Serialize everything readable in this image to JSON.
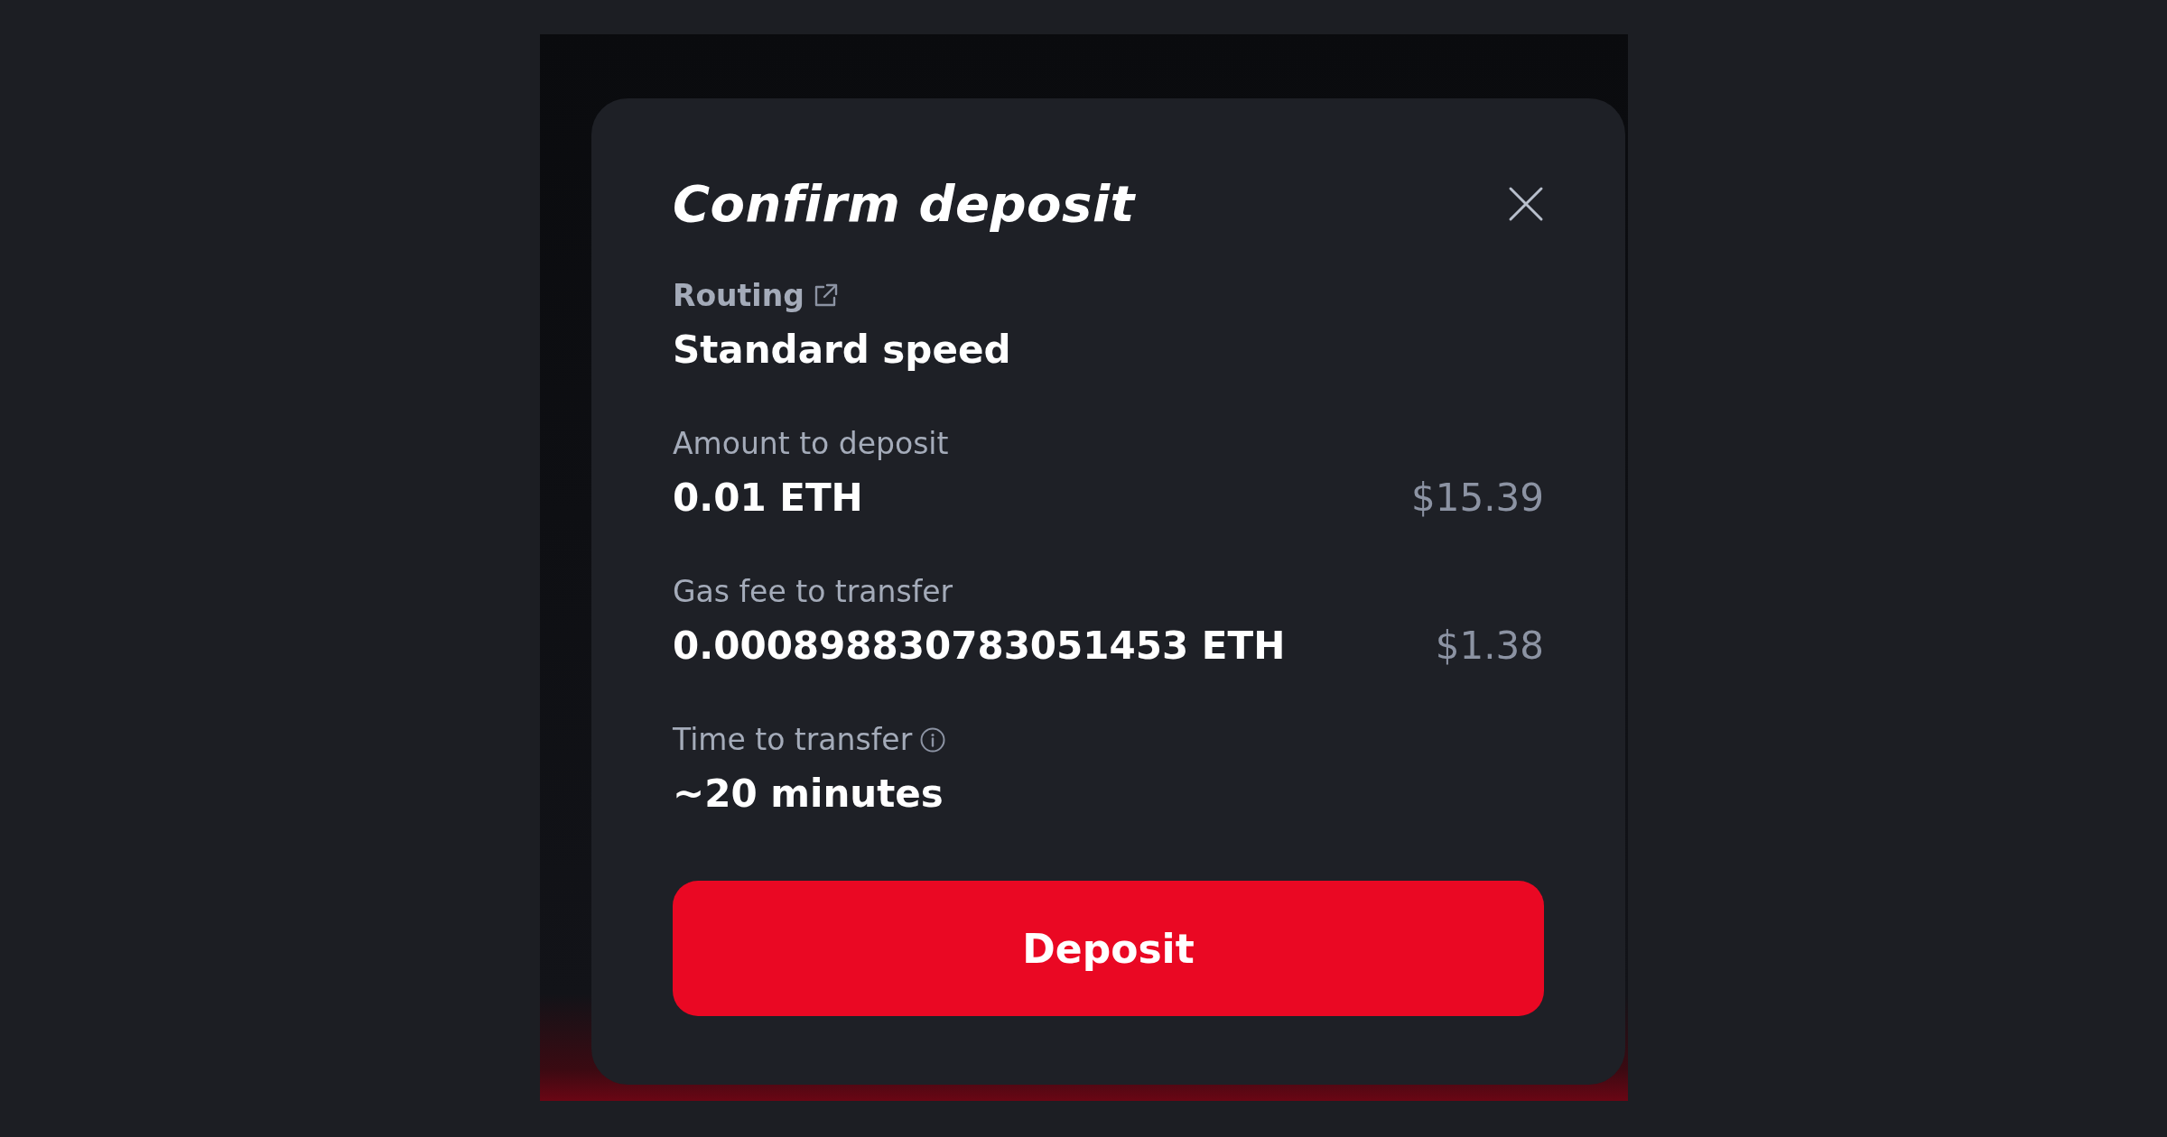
{
  "dialog": {
    "title": "Confirm deposit"
  },
  "rows": [
    {
      "label": "Routing",
      "kind": "link",
      "value": "Standard speed"
    },
    {
      "label": "Amount to deposit",
      "value": "0.01 ETH",
      "fiat": "$15.39"
    },
    {
      "label": "Gas fee to transfer",
      "value": "0.000898830783051453 ETH",
      "fiat": "$1.38"
    },
    {
      "label": "Time to transfer",
      "kind": "info",
      "value": "~20 minutes"
    }
  ],
  "button": {
    "label": "Deposit"
  }
}
